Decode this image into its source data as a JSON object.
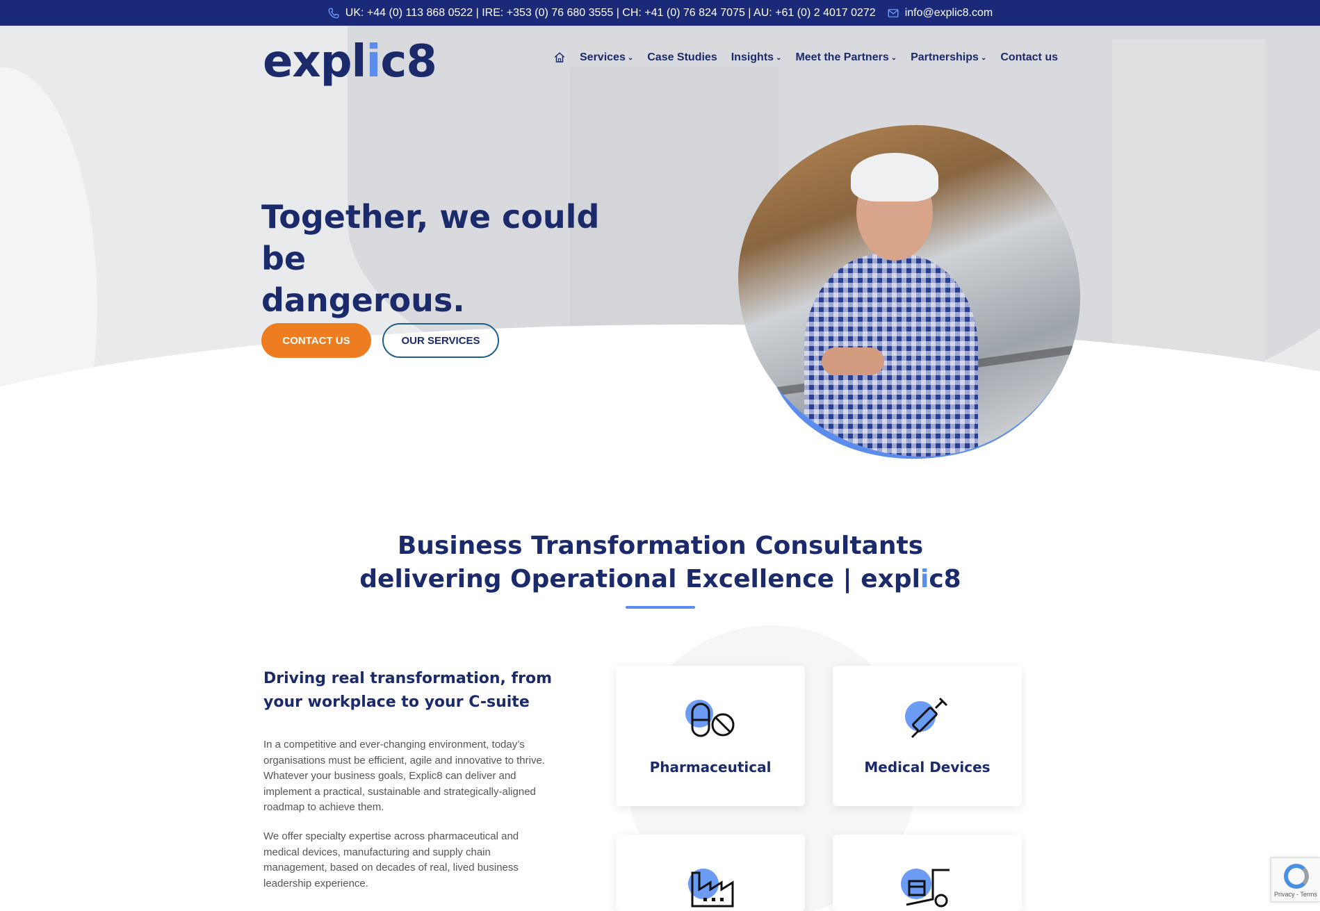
{
  "topbar": {
    "phones": "UK: +44 (0) 113 868 0522 | IRE: +353 (0) 76 680 3555 | CH: +41 (0) 76 824 7075 | AU: +61 (0) 2 4017 0272",
    "email": "info@explic8.com"
  },
  "header": {
    "logo": {
      "pre": "expl",
      "i": "i",
      "post": "c8"
    },
    "nav": [
      {
        "label": "Services",
        "dropdown": true
      },
      {
        "label": "Case Studies",
        "dropdown": false
      },
      {
        "label": "Insights",
        "dropdown": true
      },
      {
        "label": "Meet the Partners",
        "dropdown": true
      },
      {
        "label": "Partnerships",
        "dropdown": true
      },
      {
        "label": "Contact us",
        "dropdown": false
      }
    ]
  },
  "hero": {
    "title_line1": "Together, we could be",
    "title_line2": "dangerous.",
    "contact_button": "CONTACT US",
    "services_button": "OUR SERVICES"
  },
  "section": {
    "title_line1": "Business Transformation Consultants",
    "title_line2_pre": "delivering Operational Excellence | expl",
    "title_line2_i": "i",
    "title_line2_post": "c8",
    "subtitle": "Driving real transformation, from your workplace to your C-suite",
    "paragraph1": "In a competitive and ever-changing environment, today’s organisations must be efficient, agile and innovative to thrive. Whatever your business goals, Explic8 can deliver and implement a practical, sustainable and strategically-aligned roadmap to achieve them.",
    "paragraph2": "We offer specialty expertise across pharmaceutical and medical devices, manufacturing and supply chain management, based on decades of real, lived business leadership experience."
  },
  "cards": [
    {
      "label": "Pharmaceutical",
      "icon": "pill-icon"
    },
    {
      "label": "Medical Devices",
      "icon": "syringe-icon"
    },
    {
      "label": "",
      "icon": "factory-icon"
    },
    {
      "label": "",
      "icon": "hand-truck-icon"
    }
  ],
  "recaptcha": {
    "text": "Privacy - Terms"
  },
  "colors": {
    "navy": "#1b2a6b",
    "topbar": "#1b2a78",
    "accent_blue": "#5b8def",
    "orange": "#ee7d22"
  }
}
